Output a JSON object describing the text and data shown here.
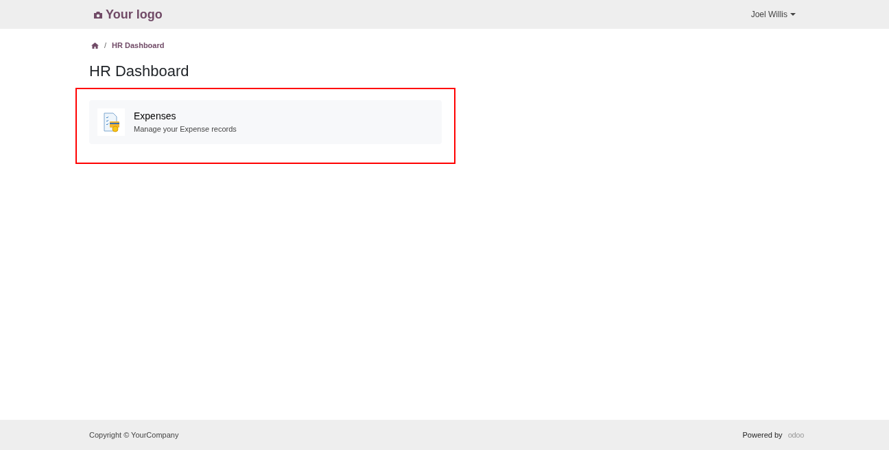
{
  "navbar": {
    "logo": "Your logo",
    "user": "Joel Willis"
  },
  "breadcrumb": {
    "separator": "/",
    "current": "HR Dashboard"
  },
  "page_title": "HR Dashboard",
  "cards": [
    {
      "title": "Expenses",
      "description": "Manage your Expense records"
    }
  ],
  "footer": {
    "copyright": "Copyright © YourCompany",
    "powered_by": "Powered by",
    "brand": "odoo"
  }
}
